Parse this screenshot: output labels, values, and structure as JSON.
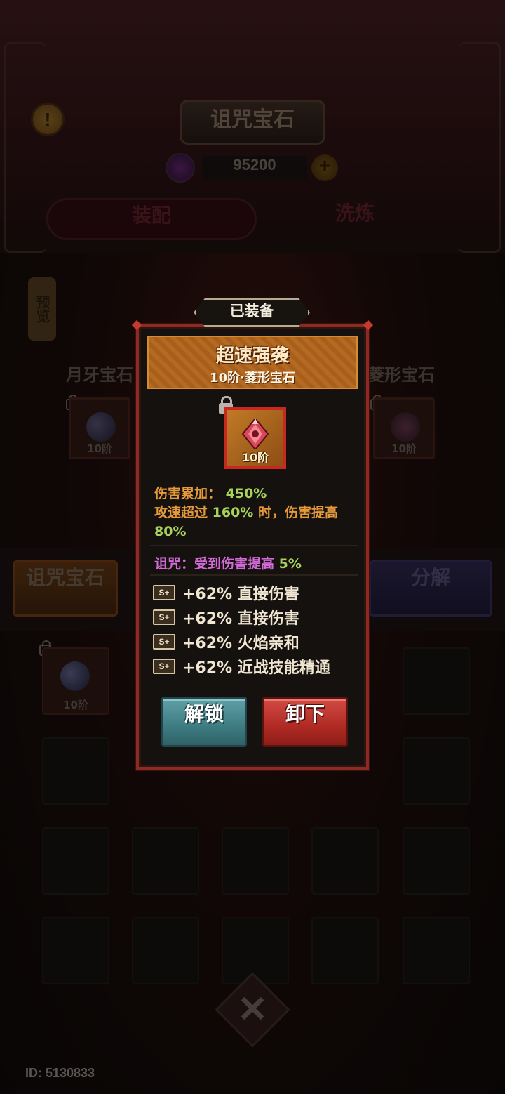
{
  "background": {
    "title": "诅咒宝石",
    "currency": {
      "value": "95200",
      "icon": "gem-icon",
      "add_icon": "plus-icon"
    },
    "tabs": [
      {
        "label": "装配"
      },
      {
        "label": "洗炼"
      }
    ],
    "side_pill": "预览",
    "left_slot": {
      "label": "月牙宝石",
      "tier": "10阶"
    },
    "right_slot": {
      "label": "菱形宝石",
      "tier": "10阶"
    },
    "curse_gem_button": "诅咒宝石",
    "decompose_button": "分解",
    "inventory": [
      {
        "tier": "10阶",
        "locked": true
      }
    ],
    "user_id": "ID: 5130833",
    "close_icon": "close-x-icon"
  },
  "modal": {
    "status": "已装备",
    "gem_name": "超速强袭",
    "gem_subtitle": "10阶·菱形宝石",
    "gem_tier": "10阶",
    "locked": true,
    "stats": {
      "damage_stack_label": "伤害累加：",
      "damage_stack_value": "450%",
      "attack_speed_prefix": "攻速超过",
      "attack_speed_threshold": "160%",
      "attack_speed_suffix": "时，伤害提高",
      "attack_speed_bonus": "80%"
    },
    "curse": {
      "label": "诅咒：受到伤害提高",
      "value": "5%"
    },
    "affixes": [
      {
        "grade": "S+",
        "text": "+62% 直接伤害"
      },
      {
        "grade": "S+",
        "text": "+62% 直接伤害"
      },
      {
        "grade": "S+",
        "text": "+62% 火焰亲和"
      },
      {
        "grade": "S+",
        "text": "+62% 近战技能精通"
      }
    ],
    "buttons": {
      "unlock": "解锁",
      "unequip": "卸下"
    },
    "colors": {
      "frame": "#8e2a24",
      "name_plate": "#b26720",
      "stat_orange": "#e79a3c",
      "stat_green": "#a8d25a",
      "curse_pink": "#d26ad8",
      "unlock_teal": "#3d7c82",
      "unequip_red": "#b02a24"
    }
  }
}
